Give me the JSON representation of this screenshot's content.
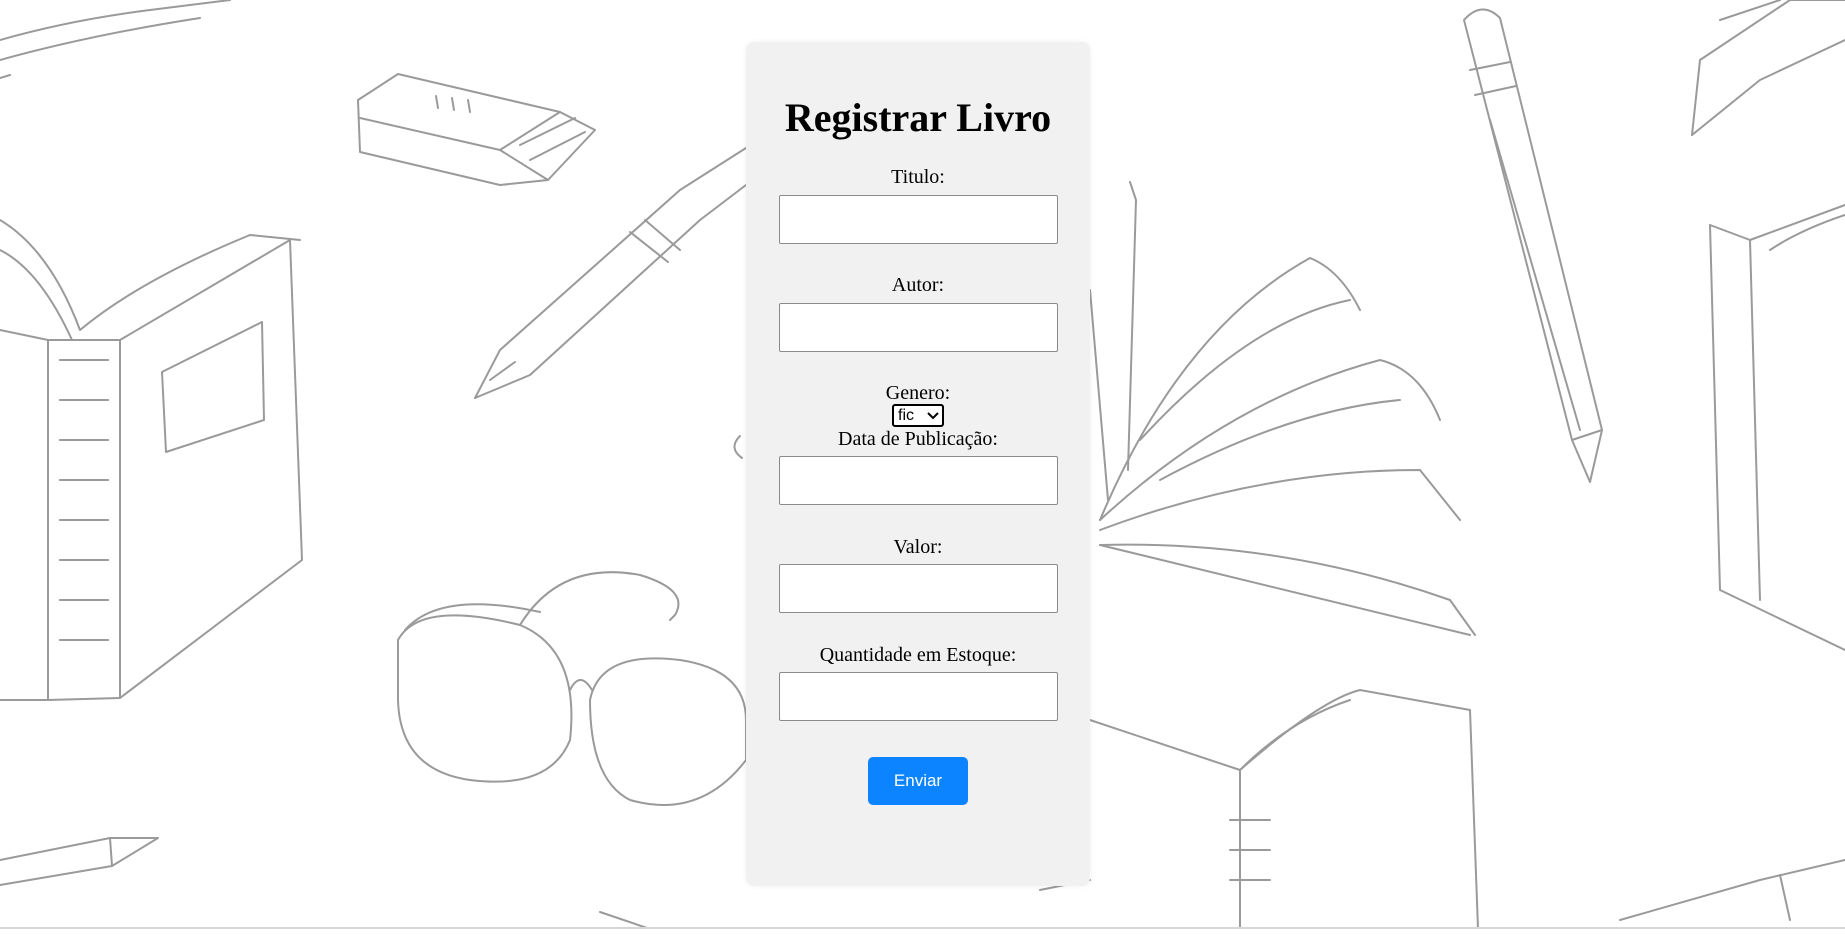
{
  "form": {
    "title": "Registrar Livro",
    "fields": {
      "titulo": {
        "label": "Titulo:",
        "value": "",
        "placeholder": ""
      },
      "autor": {
        "label": "Autor:",
        "value": "",
        "placeholder": ""
      },
      "genero": {
        "label": "Genero:",
        "selected": "fic"
      },
      "data_publicacao": {
        "label": "Data de Publicação:",
        "value": "",
        "placeholder": ""
      },
      "valor": {
        "label": "Valor:",
        "value": "",
        "placeholder": ""
      },
      "quantidade": {
        "label": "Quantidade em Estoque:",
        "value": "",
        "placeholder": ""
      }
    },
    "submit_label": "Enviar"
  },
  "colors": {
    "card_background": "#f1f1f1",
    "submit_button": "#0d84ff",
    "sketch_stroke": "#9a9a9a"
  }
}
